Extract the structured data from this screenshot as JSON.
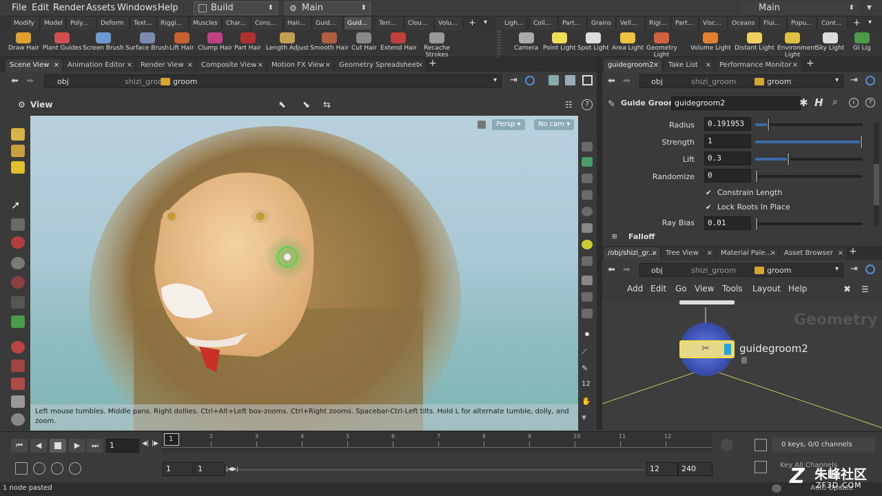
{
  "menubar": {
    "items": [
      "File",
      "Edit",
      "Render",
      "Assets",
      "Windows",
      "Help"
    ],
    "desktop": "Build",
    "network": "Main",
    "right_desktop": "Main"
  },
  "shelf_tabs_left": [
    "Modify",
    "Model",
    "Poly...",
    "Deform",
    "Text...",
    "Riggi...",
    "Muscles",
    "Char...",
    "Cons...",
    "Hair...",
    "Guid...",
    "Guid...",
    "Terr...",
    "Clou...",
    "Volu..."
  ],
  "shelf_tabs_right": [
    "Ligh...",
    "Coll...",
    "Part...",
    "Grains",
    "Vell...",
    "Rigi...",
    "Part...",
    "Visc...",
    "Oceans",
    "Flui...",
    "Popu...",
    "Cont..."
  ],
  "shelf_tools_left": [
    "Draw Hair",
    "Plant Guides",
    "Screen Brush",
    "Surface Brush",
    "Lift Hair",
    "Clump Hair",
    "Part Hair",
    "Length Adjust",
    "Smooth Hair",
    "Cut Hair",
    "Extend Hair",
    "Recache Strokes"
  ],
  "shelf_tools_right": [
    "Camera",
    "Point Light",
    "Spot Light",
    "Area Light",
    "Geometry Light",
    "Volume Light",
    "Distant Light",
    "Environment Light",
    "Sky Light",
    "GI Lig"
  ],
  "left_pane": {
    "tabs": [
      "Scene View",
      "Animation Editor",
      "Render View",
      "Composite View",
      "Motion FX View",
      "Geometry Spreadsheet"
    ],
    "path": [
      "obj",
      "shizi_groom",
      "groom"
    ],
    "view_label": "View",
    "persp": "Persp",
    "cam": "No cam",
    "hint": "Left mouse tumbles. Middle pans. Right dollies. Ctrl+Alt+Left box-zooms. Ctrl+Right zooms. Spacebar-Ctrl-Left tilts. Hold L for alternate tumble, dolly, and zoom."
  },
  "params_pane": {
    "tabs": [
      "guidegroom2",
      "Take List",
      "Performance Monitor"
    ],
    "path": [
      "obj",
      "shizi_groom",
      "groom"
    ],
    "node_type": "Guide Groom",
    "node_name": "guidegroom2",
    "params": [
      {
        "label": "Radius",
        "value": "0.191953",
        "level": 0.11
      },
      {
        "label": "Strength",
        "value": "1",
        "level": 1.0
      },
      {
        "label": "Lift",
        "value": "0.3",
        "level": 0.3
      },
      {
        "label": "Randomize",
        "value": "0",
        "level": 0.0
      }
    ],
    "checks": [
      "Constrain Length",
      "Lock Roots In Place"
    ],
    "ray_bias": {
      "label": "Ray Bias",
      "value": "0.01"
    },
    "section": "Falloff"
  },
  "network_pane": {
    "tabs": [
      "/obj/shizi_gr...",
      "Tree View",
      "Material Pale...",
      "Asset Browser"
    ],
    "path": [
      "obj",
      "shizi_groom",
      "groom"
    ],
    "menus": [
      "Add",
      "Edit",
      "Go",
      "View",
      "Tools",
      "Layout",
      "Help"
    ],
    "context_label": "Geometry",
    "node_label": "guidegroom2"
  },
  "timeline": {
    "frame": "1",
    "ticks": [
      "1",
      "2",
      "3",
      "4",
      "5",
      "6",
      "7",
      "8",
      "9",
      "10",
      "11",
      "12"
    ],
    "start": "1",
    "start2": "1",
    "end": "12",
    "end2": "240",
    "keys": "0 keys, 0/0 channels",
    "key_all": "Key All Channels",
    "auto_update": "Auto Update"
  },
  "status": "1 node pasted",
  "watermark": {
    "text": "朱峰社区",
    "url": "ZF3D.COM"
  }
}
